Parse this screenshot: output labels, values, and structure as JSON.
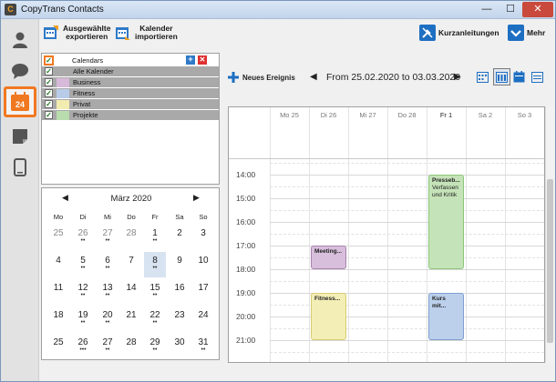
{
  "window": {
    "app_icon": "C",
    "title": "CopyTrans Contacts",
    "minimize": "—",
    "maximize": "☐",
    "close": "✕"
  },
  "sidebar": [
    {
      "name": "contacts-icon"
    },
    {
      "name": "messages-icon"
    },
    {
      "name": "calendar-icon",
      "label": "24",
      "active": true
    },
    {
      "name": "notes-icon"
    },
    {
      "name": "phone-icon"
    }
  ],
  "toolbar": {
    "export_label_1": "Ausgewählte",
    "export_label_2": "exportieren",
    "import_label_1": "Kalender",
    "import_label_2": "importieren",
    "guides_label": "Kurzanleitungen",
    "more_label": "Mehr",
    "new_event_label": "Neues Ereignis",
    "range_label": "From 25.02.2020 to 03.03.2020",
    "prev": "◀",
    "next": "▶"
  },
  "calendars": {
    "header": "Calendars",
    "add": "+",
    "remove": "✕",
    "items": [
      {
        "name": "Alle Kalender",
        "color": "#a9a9a9",
        "checked": true
      },
      {
        "name": "Business",
        "color": "#d7b9d9",
        "checked": true
      },
      {
        "name": "Fitness",
        "color": "#b8cbe8",
        "checked": true
      },
      {
        "name": "Privat",
        "color": "#f2ecb0",
        "checked": true
      },
      {
        "name": "Projekte",
        "color": "#b9dcae",
        "checked": true
      }
    ]
  },
  "mini_calendar": {
    "month": "März 2020",
    "prev": "◀",
    "next": "▶",
    "weekdays": [
      "Mo",
      "Di",
      "Mi",
      "Do",
      "Fr",
      "Sa",
      "So"
    ],
    "weeks": [
      [
        {
          "d": "25",
          "muted": true,
          "dots": ""
        },
        {
          "d": "26",
          "muted": true,
          "dots": "••"
        },
        {
          "d": "27",
          "muted": true,
          "dots": "••"
        },
        {
          "d": "28",
          "muted": true,
          "dots": ""
        },
        {
          "d": "1",
          "muted": false,
          "dots": "••"
        },
        {
          "d": "2",
          "muted": false,
          "dots": ""
        },
        {
          "d": "3",
          "muted": false,
          "dots": ""
        }
      ],
      [
        {
          "d": "4",
          "muted": false,
          "dots": ""
        },
        {
          "d": "5",
          "muted": false,
          "dots": "••"
        },
        {
          "d": "6",
          "muted": false,
          "dots": "••"
        },
        {
          "d": "7",
          "muted": false,
          "dots": ""
        },
        {
          "d": "8",
          "muted": false,
          "dots": "••",
          "selected": true
        },
        {
          "d": "9",
          "muted": false,
          "dots": ""
        },
        {
          "d": "10",
          "muted": false,
          "dots": ""
        }
      ],
      [
        {
          "d": "11",
          "muted": false,
          "dots": ""
        },
        {
          "d": "12",
          "muted": false,
          "dots": "••"
        },
        {
          "d": "13",
          "muted": false,
          "dots": "••"
        },
        {
          "d": "14",
          "muted": false,
          "dots": ""
        },
        {
          "d": "15",
          "muted": false,
          "dots": "••"
        },
        {
          "d": "16",
          "muted": false,
          "dots": ""
        },
        {
          "d": "17",
          "muted": false,
          "dots": ""
        }
      ],
      [
        {
          "d": "18",
          "muted": false,
          "dots": ""
        },
        {
          "d": "19",
          "muted": false,
          "dots": "••"
        },
        {
          "d": "20",
          "muted": false,
          "dots": "••"
        },
        {
          "d": "21",
          "muted": false,
          "dots": ""
        },
        {
          "d": "22",
          "muted": false,
          "dots": "••"
        },
        {
          "d": "23",
          "muted": false,
          "dots": ""
        },
        {
          "d": "24",
          "muted": false,
          "dots": ""
        }
      ],
      [
        {
          "d": "25",
          "muted": false,
          "dots": ""
        },
        {
          "d": "26",
          "muted": false,
          "dots": "•••"
        },
        {
          "d": "27",
          "muted": false,
          "dots": "••"
        },
        {
          "d": "28",
          "muted": false,
          "dots": ""
        },
        {
          "d": "29",
          "muted": false,
          "dots": "••"
        },
        {
          "d": "30",
          "muted": false,
          "dots": ""
        },
        {
          "d": "31",
          "muted": false,
          "dots": "••"
        }
      ]
    ]
  },
  "week_view": {
    "days": [
      "Mo 25",
      "Di 26",
      "Mi 27",
      "Do 28",
      "Fr 1",
      "Sa 2",
      "So 3"
    ],
    "times": [
      "14:00",
      "15:00",
      "16:00",
      "17:00",
      "18:00",
      "19:00",
      "20:00",
      "21:00"
    ],
    "events": [
      {
        "title": "Presseb...",
        "sub1": "Verfassen",
        "sub2": "und Kritik",
        "day": 4,
        "start": 14.0,
        "end": 18.0,
        "color": "#c5e3b8",
        "border": "#8cc57a"
      },
      {
        "title": "Meeting...",
        "sub1": "",
        "sub2": "",
        "day": 1,
        "start": 17.0,
        "end": 18.0,
        "color": "#d8bfdc",
        "border": "#a982ae"
      },
      {
        "title": "Fitness...",
        "sub1": "",
        "sub2": "",
        "day": 1,
        "start": 19.0,
        "end": 21.0,
        "color": "#f3eeb5",
        "border": "#d8cc72"
      },
      {
        "title": "Kurs mit...",
        "sub1": "",
        "sub2": "",
        "day": 4,
        "start": 19.0,
        "end": 21.0,
        "color": "#bcd0ec",
        "border": "#7f9fcf"
      }
    ]
  },
  "colors": {
    "accent": "#f07820",
    "blue": "#1e6fc2",
    "grid": "#e2e2e2"
  }
}
